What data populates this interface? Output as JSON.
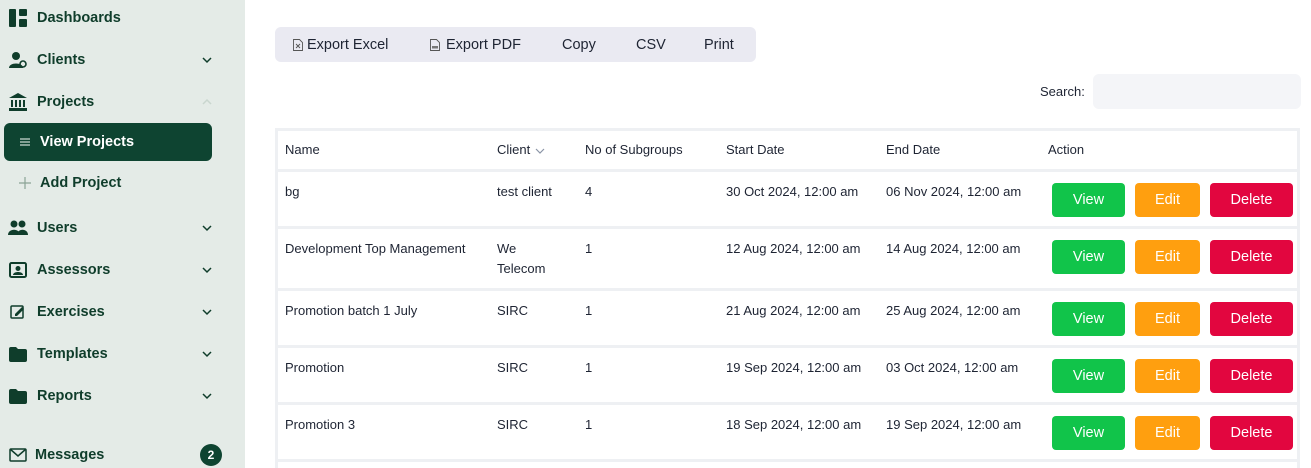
{
  "sidebar": {
    "dashboards": "Dashboards",
    "clients": "Clients",
    "projects": "Projects",
    "view_projects": "View Projects",
    "add_project": "Add Project",
    "users": "Users",
    "assessors": "Assessors",
    "exercises": "Exercises",
    "templates": "Templates",
    "reports": "Reports",
    "messages": "Messages",
    "messages_count": "2"
  },
  "toolbar": {
    "export_excel": "Export Excel",
    "export_pdf": "Export PDF",
    "copy": "Copy",
    "csv": "CSV",
    "print": "Print"
  },
  "search": {
    "label": "Search:",
    "value": "",
    "placeholder": ""
  },
  "table": {
    "headers": {
      "name": "Name",
      "client": "Client",
      "subgroups": "No of Subgroups",
      "start": "Start Date",
      "end": "End Date",
      "action": "Action"
    },
    "actions": {
      "view": "View",
      "edit": "Edit",
      "delete": "Delete"
    },
    "rows": [
      {
        "name": "bg",
        "client_line1": "test client",
        "client_line2": "",
        "subgroups": "4",
        "start": "30 Oct 2024, 12:00 am",
        "end": "06 Nov 2024, 12:00 am"
      },
      {
        "name": "Development Top Management",
        "client_line1": "We",
        "client_line2": "Telecom",
        "subgroups": "1",
        "start": "12 Aug 2024, 12:00 am",
        "end": "14 Aug 2024, 12:00 am"
      },
      {
        "name": "Promotion batch 1 July",
        "client_line1": "SIRC",
        "client_line2": "",
        "subgroups": "1",
        "start": "21 Aug 2024, 12:00 am",
        "end": "25 Aug 2024, 12:00 am"
      },
      {
        "name": "Promotion",
        "client_line1": "SIRC",
        "client_line2": "",
        "subgroups": "1",
        "start": "19 Sep 2024, 12:00 am",
        "end": "03 Oct 2024, 12:00 am"
      },
      {
        "name": "Promotion 3",
        "client_line1": "SIRC",
        "client_line2": "",
        "subgroups": "1",
        "start": "18 Sep 2024, 12:00 am",
        "end": "19 Sep 2024, 12:00 am"
      }
    ]
  },
  "colors": {
    "sidebar_bg": "#e4ebe7",
    "brand_dark": "#0e4431",
    "view": "#11c44a",
    "edit": "#ff9f0f",
    "delete": "#e2063f"
  }
}
